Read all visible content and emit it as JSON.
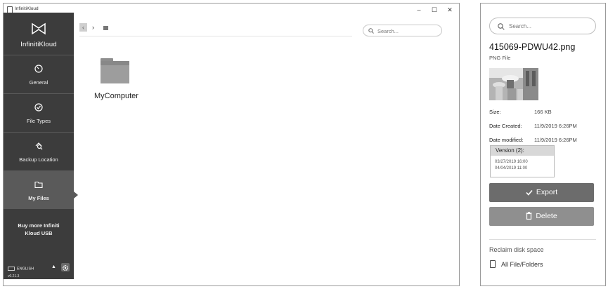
{
  "window": {
    "title": "InfinitiKloud",
    "controls": {
      "minimize": "–",
      "maximize": "☐",
      "close": "✕"
    }
  },
  "sidebar": {
    "brand": "InfinitiKloud",
    "items": [
      {
        "label": "General",
        "icon": "gauge-icon"
      },
      {
        "label": "File Types",
        "icon": "check-circle-icon"
      },
      {
        "label": "Backup Location",
        "icon": "location-search-icon"
      },
      {
        "label": "My Files",
        "icon": "folder-icon",
        "active": true
      }
    ],
    "buy_line1": "Buy more Infiniti",
    "buy_line2": "Kloud USB",
    "language": "ENGLISH",
    "version": "v0.21.3"
  },
  "main": {
    "search_placeholder": "Search...",
    "folder_name": "MyComputer"
  },
  "panel": {
    "search_placeholder": "Search...",
    "file_name": "415069-PDWU42.png",
    "file_type": "PNG File",
    "size_label": "Size:",
    "size_value": "166 KB",
    "created_label": "Date Created:",
    "created_value": "11/9/2019 6:26PM",
    "modified_label": "Date modified:",
    "modified_value": "11/9/2019 6:26PM",
    "version_header": "Version (2):",
    "versions": [
      "03/27/2019 16:00",
      "04/04/2019 11:00"
    ],
    "export_label": "Export",
    "delete_label": "Delete",
    "reclaim_label": "Reclaim disk space",
    "all_files_label": "All File/Folders"
  }
}
